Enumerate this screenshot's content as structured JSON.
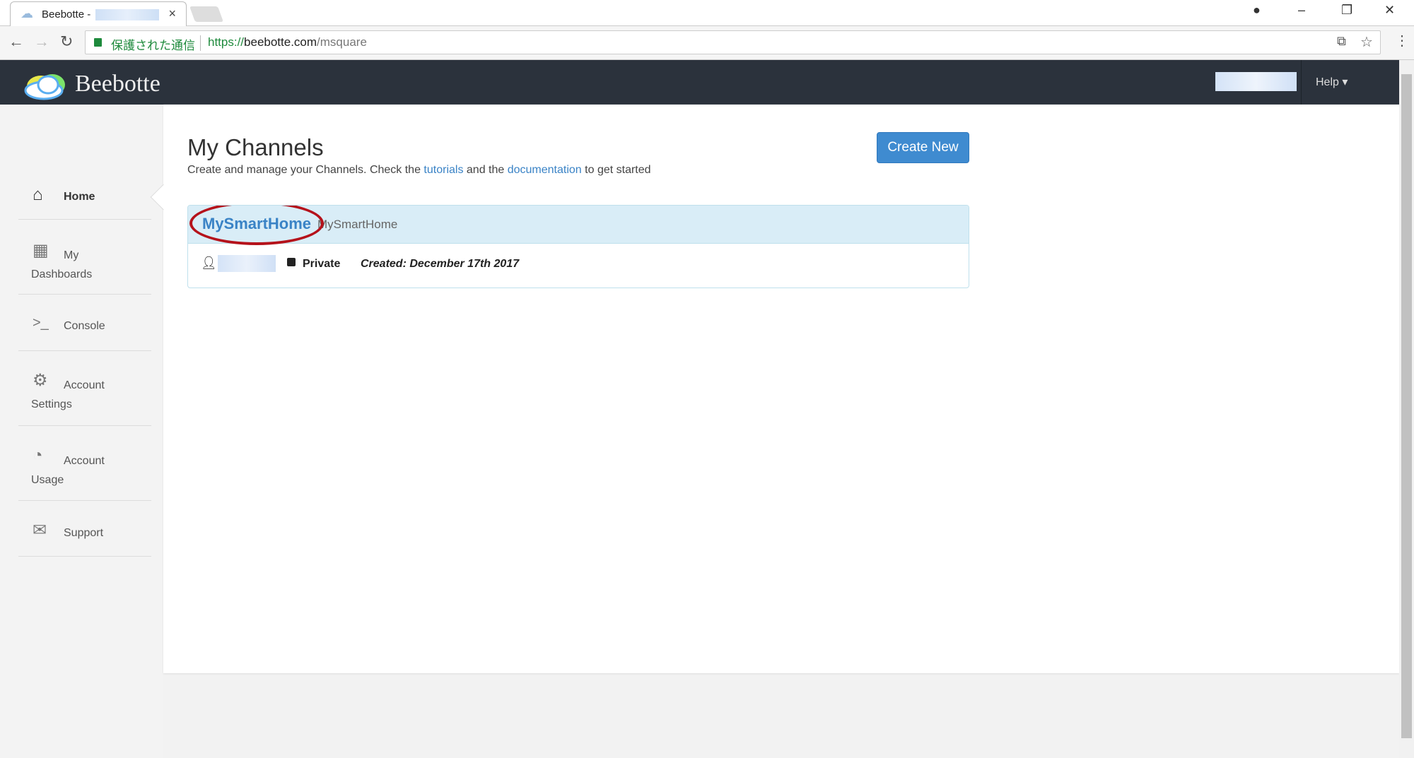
{
  "browser": {
    "tab_title": "Beebotte - ",
    "secure_label": "保護された通信",
    "url_scheme": "https://",
    "url_host": "beebotte.com",
    "url_path": "/msquare"
  },
  "navbar": {
    "brand": "Beebotte",
    "help": "Help ▾"
  },
  "sidebar": {
    "items": [
      {
        "label": "Home",
        "icon": "home-icon"
      },
      {
        "label": "My Dashboards",
        "icon": "dashboard-icon"
      },
      {
        "label": "Console",
        "icon": "terminal-icon"
      },
      {
        "label": "Account Settings",
        "icon": "gears-icon"
      },
      {
        "label": "Account Usage",
        "icon": "gauge-icon"
      },
      {
        "label": "Support",
        "icon": "envelope-icon"
      }
    ]
  },
  "main": {
    "title": "My Channels",
    "subtitle_pre": "Create and manage your Channels. Check the ",
    "link1": "tutorials",
    "subtitle_mid": " and the ",
    "link2": "documentation",
    "subtitle_post": " to get started",
    "create_button": "Create New",
    "channel": {
      "name": "MySmartHome",
      "description": "MySmartHome",
      "visibility": "Private",
      "created": "Created: December 17th 2017"
    }
  },
  "colors": {
    "accent": "#3f8bd0",
    "navbar": "#2b323c",
    "highlight": "#b5121b"
  }
}
